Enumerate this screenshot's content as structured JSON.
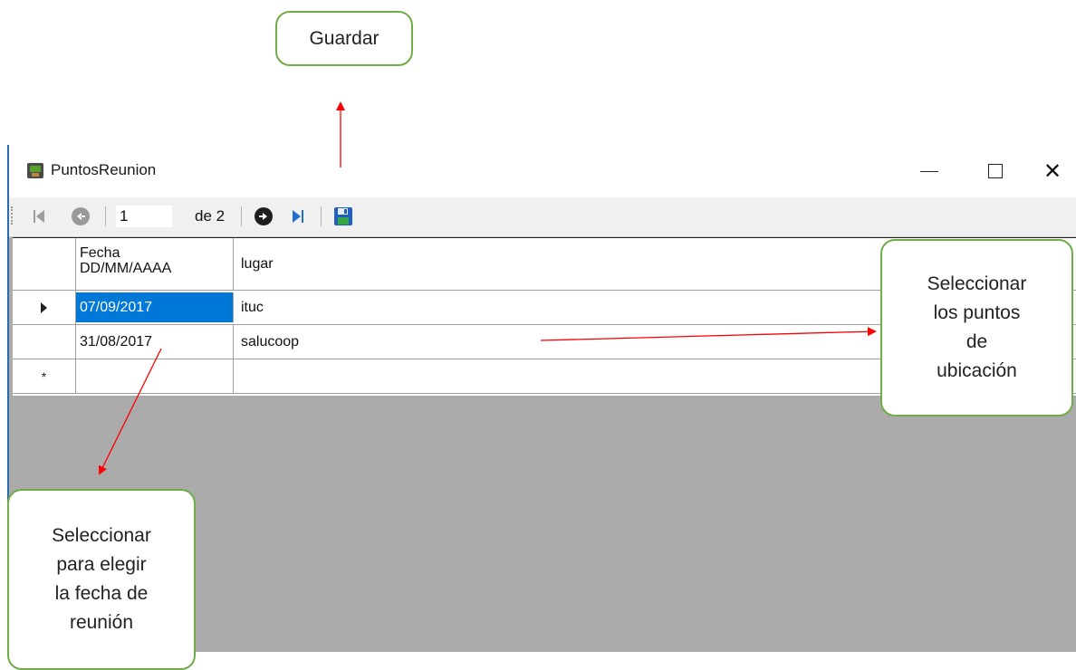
{
  "callouts": {
    "guardar": "Guardar",
    "lugar": [
      "Seleccionar",
      "los puntos",
      "de",
      "ubicación"
    ],
    "fecha": [
      "Seleccionar",
      "para elegir",
      "la fecha de",
      "reunión"
    ]
  },
  "window": {
    "title": "PuntosReunion"
  },
  "navigator": {
    "position": "1",
    "count_label": "de 2"
  },
  "grid": {
    "columns": [
      "Fecha DD/MM/AAAA",
      "lugar"
    ],
    "column_fecha_line1": "Fecha",
    "column_fecha_line2": "DD/MM/AAAA",
    "rows": [
      {
        "fecha": "07/09/2017",
        "lugar": "ituc",
        "selected": true
      },
      {
        "fecha": "31/08/2017",
        "lugar": "salucoop",
        "selected": false
      }
    ],
    "new_row_marker": "*"
  },
  "icons": {
    "first": "move-first-icon",
    "previous": "move-previous-icon",
    "next": "move-next-icon",
    "last": "move-last-icon",
    "save": "save-disk-icon",
    "row_current": "current-row-arrow-icon",
    "row_new": "new-row-asterisk-icon"
  },
  "colors": {
    "callout_border": "#70ad47",
    "arrow": "#ff0000",
    "selection": "#0078d7",
    "grid_background": "#ababab"
  }
}
